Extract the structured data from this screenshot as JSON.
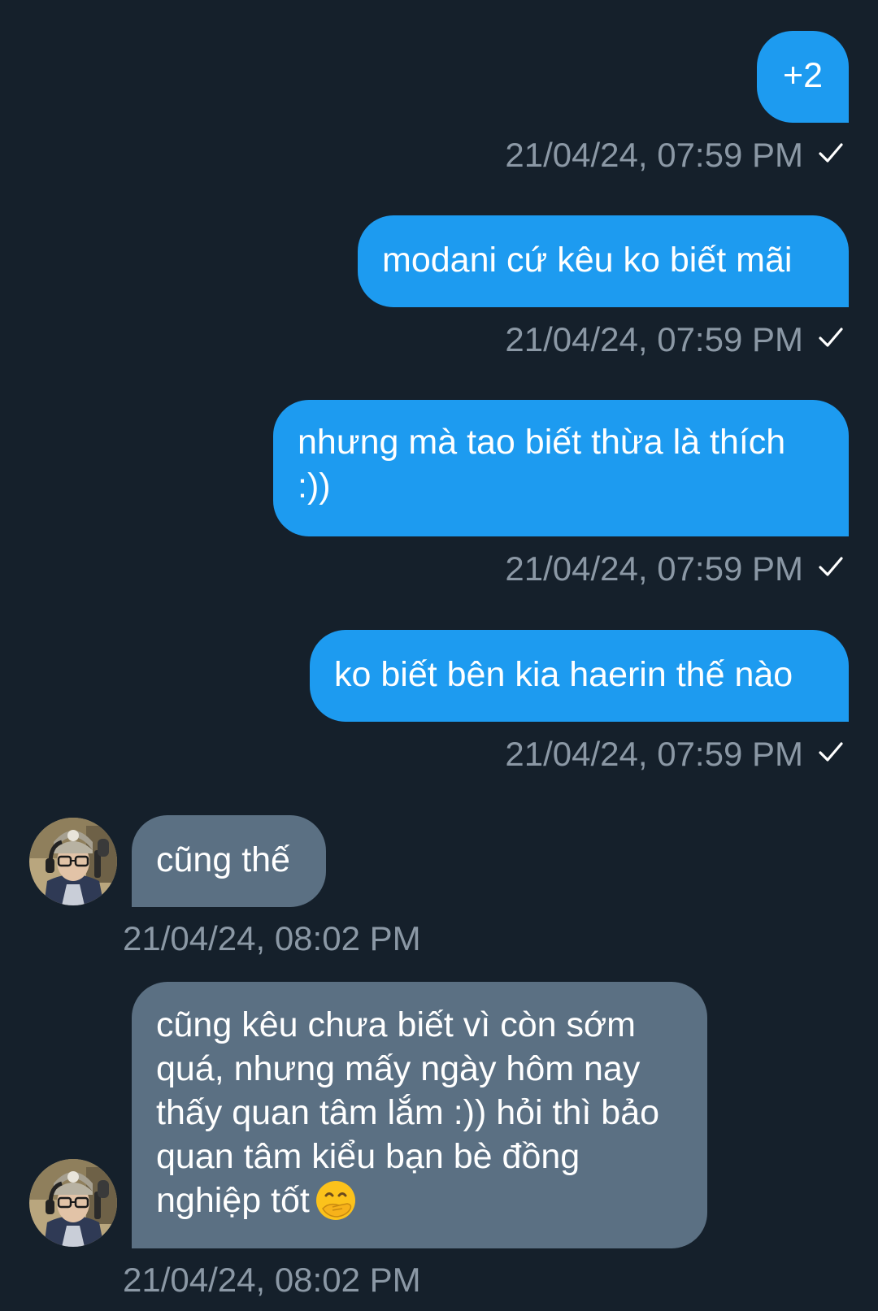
{
  "messages": [
    {
      "direction": "outgoing",
      "text": "+2",
      "timestamp": "21/04/24, 07:59 PM",
      "status_icon": "sent-check-icon"
    },
    {
      "direction": "outgoing",
      "text": "modani cứ kêu ko biết mãi",
      "timestamp": "21/04/24, 07:59 PM",
      "status_icon": "sent-check-icon"
    },
    {
      "direction": "outgoing",
      "text": "nhưng mà tao biết thừa là thích :))",
      "timestamp": "21/04/24, 07:59 PM",
      "status_icon": "sent-check-icon"
    },
    {
      "direction": "outgoing",
      "text": "ko biết bên kia haerin thế nào",
      "timestamp": "21/04/24, 07:59 PM",
      "status_icon": "sent-check-icon"
    },
    {
      "direction": "incoming",
      "text": "cũng thế",
      "timestamp": "21/04/24, 08:02 PM",
      "avatar_icon": "contact-avatar"
    },
    {
      "direction": "incoming",
      "text": "cũng kêu chưa biết vì còn sớm quá, nhưng mấy ngày hôm nay thấy quan tâm lắm :)) hỏi thì bảo quan tâm kiểu bạn bè đồng nghiệp tốt",
      "emoji": "face-with-hand-over-mouth-emoji",
      "timestamp": "21/04/24, 08:02 PM",
      "avatar_icon": "contact-avatar"
    }
  ],
  "colors": {
    "background": "#15202b",
    "outgoing_bubble": "#1d9bf0",
    "incoming_bubble": "#5b7083",
    "timestamp_text": "#8b98a5",
    "bubble_text": "#ffffff"
  }
}
